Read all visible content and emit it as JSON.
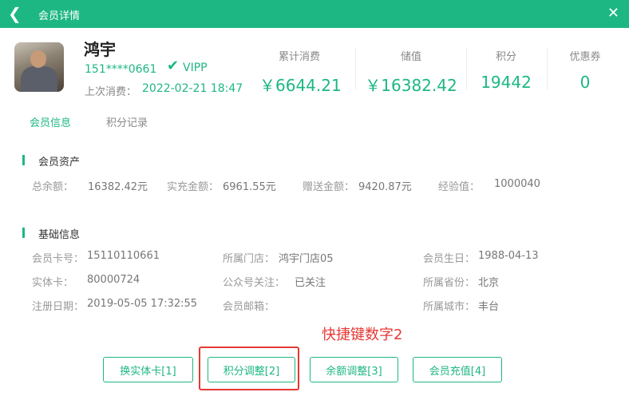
{
  "window": {
    "title": "会员详情",
    "back_icon": "chevron-left-icon",
    "close_icon": "close-icon"
  },
  "member": {
    "name": "鸿宇",
    "phone": "151****0661",
    "vip_level": "VIPP",
    "last_consume_label": "上次消费：",
    "last_consume_time": "2022-02-21 18:47"
  },
  "stats": [
    {
      "label": "累计消费",
      "value": "￥6644.21"
    },
    {
      "label": "储值",
      "value": "￥16382.42"
    },
    {
      "label": "积分",
      "value": "19442"
    },
    {
      "label": "优惠券",
      "value": "0"
    }
  ],
  "tabs": [
    {
      "label": "会员信息",
      "active": true
    },
    {
      "label": "积分记录",
      "active": false
    }
  ],
  "assets": {
    "title": "会员资产",
    "items": [
      {
        "label": "总余额：",
        "value": "16382.42元"
      },
      {
        "label": "实充金额：",
        "value": "6961.55元"
      },
      {
        "label": "赠送金额：",
        "value": "9420.87元"
      },
      {
        "label": "经验值：",
        "value": "1000040"
      }
    ]
  },
  "basic": {
    "title": "基础信息",
    "rows": [
      [
        {
          "label": "会员卡号：",
          "value": "15110110661"
        },
        {
          "label": "所属门店：",
          "value": "鸿宇门店05"
        },
        {
          "label": "会员生日：",
          "value": "1988-04-13"
        }
      ],
      [
        {
          "label": "实体卡：",
          "value": "80000724"
        },
        {
          "label": "公众号关注：",
          "value": "已关注"
        },
        {
          "label": "所属省份：",
          "value": "北京"
        }
      ],
      [
        {
          "label": "注册日期：",
          "value": "2019-05-05 17:32:55"
        },
        {
          "label": "会员邮箱：",
          "value": ""
        },
        {
          "label": "所属城市：",
          "value": "丰台"
        }
      ]
    ]
  },
  "annotation": "快捷键数字2",
  "buttons": [
    {
      "label": "换实体卡[1]"
    },
    {
      "label": "积分调整[2]"
    },
    {
      "label": "余额调整[3]"
    },
    {
      "label": "会员充值[4]"
    }
  ],
  "colors": {
    "accent": "#1db784",
    "highlight": "#e53935"
  }
}
